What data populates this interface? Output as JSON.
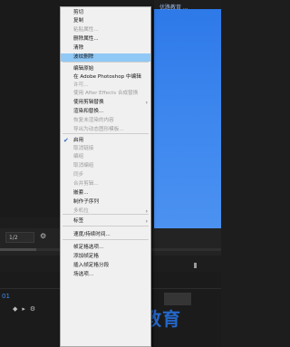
{
  "app": {
    "brand_text": "优路教育 ...",
    "zoom": "1/2",
    "timecode": "01"
  },
  "watermark": "最需教育",
  "context_menu": [
    {
      "label": "剪切",
      "enabled": true
    },
    {
      "label": "复制",
      "enabled": true
    },
    {
      "label": "粘贴属性...",
      "enabled": false
    },
    {
      "label": "删除属性...",
      "enabled": true
    },
    {
      "label": "清除",
      "enabled": true
    },
    {
      "label": "波纹删除",
      "enabled": true,
      "highlighted": true
    },
    {
      "separator": true
    },
    {
      "label": "编辑原始",
      "enabled": true
    },
    {
      "label": "在 Adobe Photoshop 中编辑",
      "enabled": true
    },
    {
      "label": "许可...",
      "enabled": false
    },
    {
      "label": "使用 After Effects 合成替换",
      "enabled": false
    },
    {
      "label": "使用剪辑替换",
      "enabled": true,
      "submenu": true
    },
    {
      "label": "渲染和替换...",
      "enabled": true
    },
    {
      "label": "恢复未渲染的内容",
      "enabled": false
    },
    {
      "label": "导出为动态图形模板...",
      "enabled": false
    },
    {
      "separator": true
    },
    {
      "label": "启用",
      "enabled": true,
      "checked": true
    },
    {
      "label": "取消链接",
      "enabled": false
    },
    {
      "label": "编组",
      "enabled": false
    },
    {
      "label": "取消编组",
      "enabled": false
    },
    {
      "label": "同步",
      "enabled": false
    },
    {
      "label": "合并剪辑...",
      "enabled": false
    },
    {
      "label": "嵌套...",
      "enabled": true
    },
    {
      "label": "制作子序列",
      "enabled": true
    },
    {
      "label": "多机位",
      "enabled": false,
      "submenu": true
    },
    {
      "separator": true
    },
    {
      "label": "标签",
      "enabled": true,
      "submenu": true
    },
    {
      "separator": true
    },
    {
      "label": "速度/持续时间...",
      "enabled": true
    },
    {
      "separator": true
    },
    {
      "label": "帧定格选项...",
      "enabled": true
    },
    {
      "label": "添加帧定格",
      "enabled": true
    },
    {
      "label": "插入帧定格分段",
      "enabled": true
    },
    {
      "label": "场选项...",
      "enabled": true
    }
  ]
}
